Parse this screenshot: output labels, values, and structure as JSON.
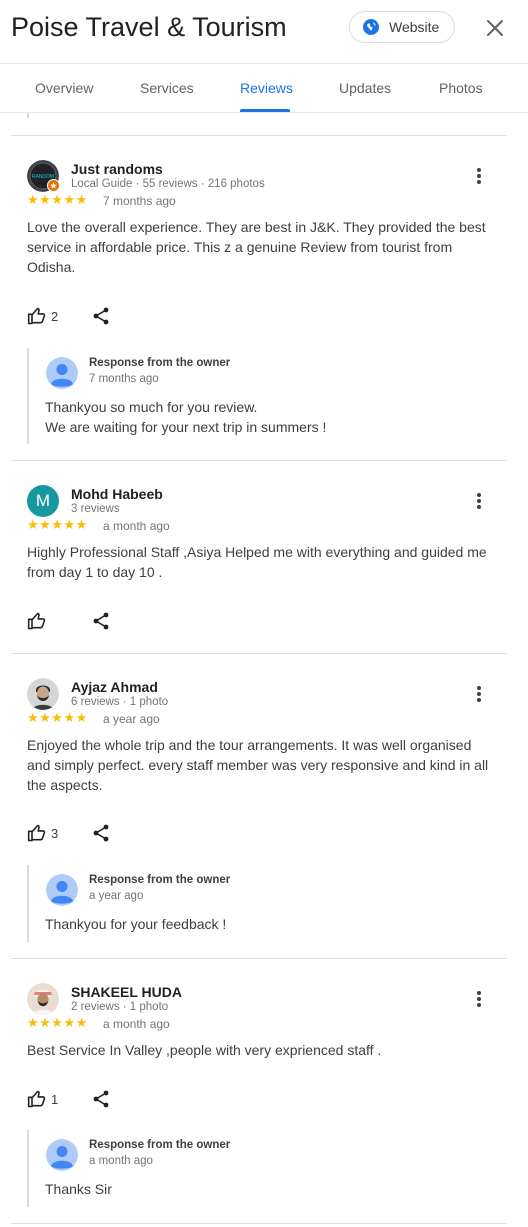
{
  "header": {
    "title": "Poise Travel & Tourism",
    "website_label": "Website",
    "globe_icon": "globe-icon",
    "close_icon": "close-icon"
  },
  "tabs": [
    {
      "label": "Overview",
      "active": false
    },
    {
      "label": "Services",
      "active": false
    },
    {
      "label": "Reviews",
      "active": true
    },
    {
      "label": "Updates",
      "active": false
    },
    {
      "label": "Photos",
      "active": false
    }
  ],
  "colors": {
    "accent": "#1a73e8",
    "star": "#fbbc04",
    "avatar_letter_bg": "#1698a1"
  },
  "reviews": [
    {
      "name": "Just randoms",
      "meta": "Local Guide · 55 reviews · 216 photos",
      "avatar_text": "RANDOM",
      "rating": 5,
      "stars": "★★★★★",
      "date": "7 months ago",
      "text": "Love the overall experience. They are best in J&K. They provided the best service in affordable price. This z a genuine Review from tourist from Odisha.",
      "likes": "2",
      "response": {
        "label": "Response from the owner",
        "date": "7 months ago",
        "text": "Thankyou so much for you review.\nWe are waiting for your next trip in summers !"
      }
    },
    {
      "name": "Mohd Habeeb",
      "meta": "3 reviews",
      "avatar_letter": "M",
      "rating": 5,
      "stars": "★★★★★",
      "date": "a month ago",
      "text": "Highly Professional Staff ,Asiya Helped me with everything and guided me from day 1 to day 10 .",
      "likes": ""
    },
    {
      "name": "Ayjaz Ahmad",
      "meta": "6 reviews · 1 photo",
      "rating": 5,
      "stars": "★★★★★",
      "date": "a year ago",
      "text": "Enjoyed the whole trip and the tour arrangements. It was well organised and simply perfect. every staff member was very responsive and kind in all the aspects.",
      "likes": "3",
      "response": {
        "label": "Response from the owner",
        "date": "a year ago",
        "text": "Thankyou for your feedback !"
      }
    },
    {
      "name": "SHAKEEL HUDA",
      "meta": "2 reviews · 1 photo",
      "rating": 5,
      "stars": "★★★★★",
      "date": "a month ago",
      "text": "Best Service In Valley ,people with very exprienced staff .",
      "likes": "1",
      "response": {
        "label": "Response from the owner",
        "date": "a month ago",
        "text": "Thanks Sir"
      }
    }
  ]
}
